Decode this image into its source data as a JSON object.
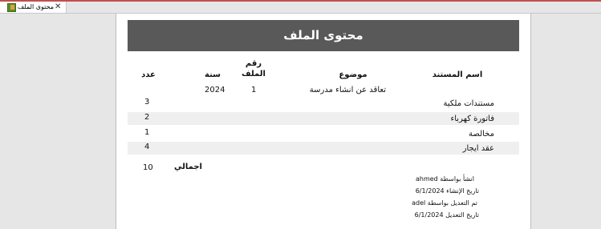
{
  "tab": {
    "title": "محتوى الملف",
    "icon": "report-icon",
    "close_icon": "close-icon"
  },
  "report": {
    "title": "محتوى الملف",
    "headers": {
      "doc_name": "اسم المستند",
      "subject": "موضوع",
      "file_no": "رقم الملف",
      "year": "سنة",
      "count": "عدد"
    },
    "group": {
      "subject": "تعاقد عن انشاء مدرسة",
      "file_no": "1",
      "year": "2024"
    },
    "rows": [
      {
        "doc_name": "مستندات ملكية",
        "count": "3"
      },
      {
        "doc_name": "فاتورة كهرباء",
        "count": "2"
      },
      {
        "doc_name": "مخالصة",
        "count": "1"
      },
      {
        "doc_name": "عقد ايجار",
        "count": "4"
      }
    ],
    "total_label": "اجمالي",
    "total_value": "10",
    "audit": {
      "created_by": "انشأ بواسطة ahmed",
      "created_date": "تاريخ الإنشاء 6/1/2024",
      "modified_by": "تم التعديل بواسطة adel",
      "modified_date": "تاريخ التعديل 6/1/2024"
    }
  },
  "colors": {
    "banner": "#595959",
    "row_shade": "#efefef",
    "accent": "#c0504d"
  }
}
